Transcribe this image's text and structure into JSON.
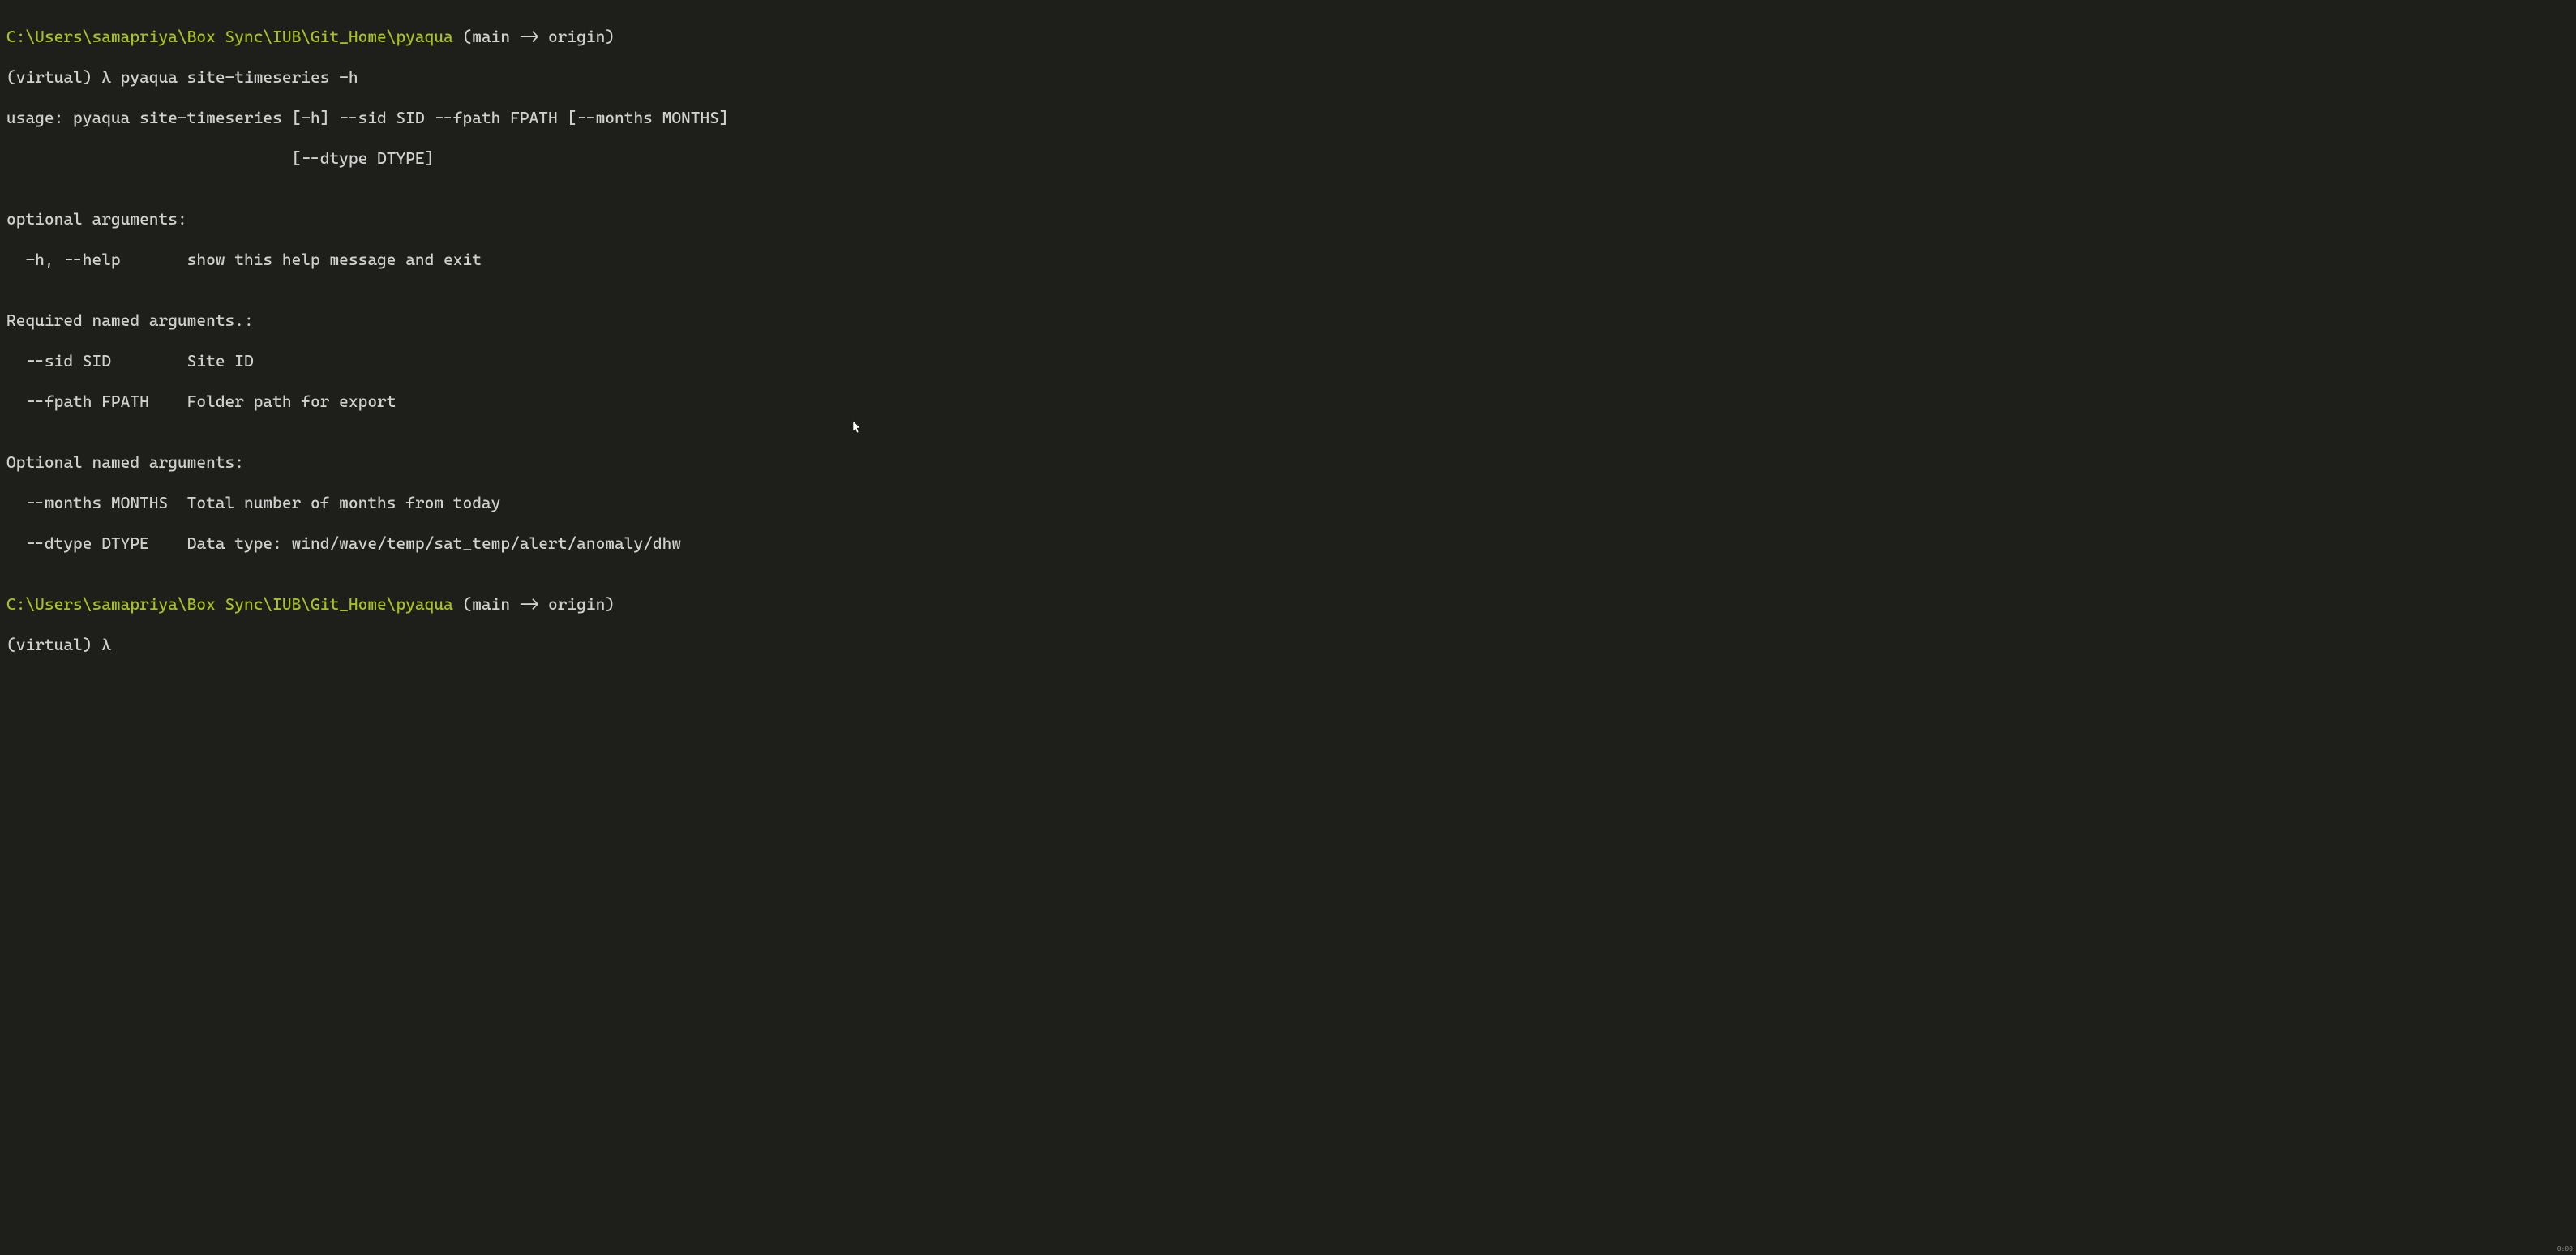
{
  "prompt1": {
    "path": "C:\\Users\\samapriya\\Box Sync\\IUB\\Git_Home\\pyaqua",
    "branch": " (main -> origin)",
    "prefix": "(virtual) ",
    "lambda": "λ ",
    "command": "pyaqua site-timeseries -h"
  },
  "output": {
    "line1": "usage: pyaqua site-timeseries [-h] --sid SID --fpath FPATH [--months MONTHS]",
    "line2": "                              [--dtype DTYPE]",
    "blank1": "",
    "line3": "optional arguments:",
    "line4": "  -h, --help       show this help message and exit",
    "blank2": "",
    "line5": "Required named arguments.:",
    "line6": "  --sid SID        Site ID",
    "line7": "  --fpath FPATH    Folder path for export",
    "blank3": "",
    "line8": "Optional named arguments:",
    "line9": "  --months MONTHS  Total number of months from today",
    "line10": "  --dtype DTYPE    Data type: wind/wave/temp/sat_temp/alert/anomaly/dhw",
    "blank4": ""
  },
  "prompt2": {
    "path": "C:\\Users\\samapriya\\Box Sync\\IUB\\Git_Home\\pyaqua",
    "branch": " (main -> origin)",
    "prefix": "(virtual) ",
    "lambda": "λ "
  },
  "rec": "0:00"
}
